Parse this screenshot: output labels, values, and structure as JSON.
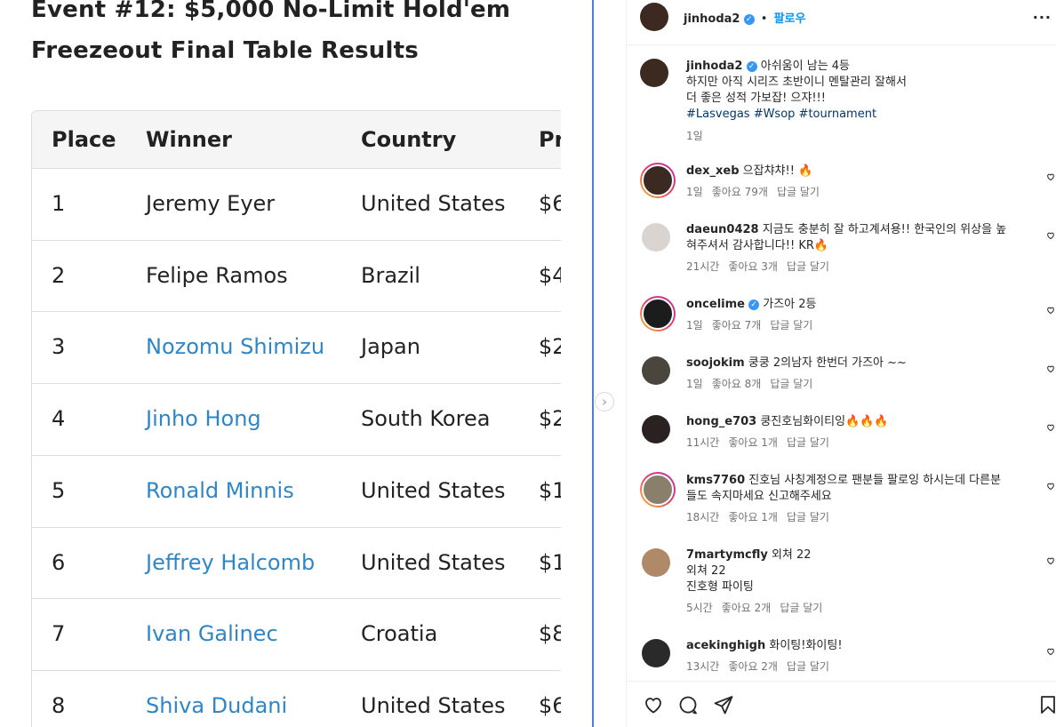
{
  "article": {
    "title": "Event #12: $5,000 No-Limit Hold'em Freezeout Final Table Results",
    "headers": [
      "Place",
      "Winner",
      "Country",
      "Pr"
    ],
    "rows": [
      {
        "place": "1",
        "winner": "Jeremy Eyer",
        "country": "United States",
        "prize": "$6",
        "link": false
      },
      {
        "place": "2",
        "winner": "Felipe Ramos",
        "country": "Brazil",
        "prize": "$4",
        "link": false
      },
      {
        "place": "3",
        "winner": "Nozomu Shimizu",
        "country": "Japan",
        "prize": "$2",
        "link": true
      },
      {
        "place": "4",
        "winner": "Jinho Hong",
        "country": "South Korea",
        "prize": "$2",
        "link": true
      },
      {
        "place": "5",
        "winner": "Ronald Minnis",
        "country": "United States",
        "prize": "$1",
        "link": true
      },
      {
        "place": "6",
        "winner": "Jeffrey Halcomb",
        "country": "United States",
        "prize": "$1",
        "link": true
      },
      {
        "place": "7",
        "winner": "Ivan Galinec",
        "country": "Croatia",
        "prize": "$8",
        "link": true
      },
      {
        "place": "8",
        "winner": "Shiva Dudani",
        "country": "United States",
        "prize": "$6",
        "link": true
      }
    ]
  },
  "post": {
    "author": "jinhoda2",
    "follow_label": "팔로우",
    "separator": "•",
    "more_label": "...",
    "caption_lines": [
      "아쉬움이 남는 4등",
      "하지만 아직 시리즈 초반이니 멘탈관리 잘해서",
      "더 좋은 성적 가보잡! 으쟈!!!"
    ],
    "hashtags": "#Lasvegas #Wsop #tournament",
    "caption_time": "1일"
  },
  "comments": [
    {
      "user": "dex_xeb",
      "verified": false,
      "lines": [
        "으잡챠챠!! 🔥"
      ],
      "time": "1일",
      "likes": "좋아요 79개",
      "reply": "답글 달기",
      "avatar": "#3a2a22",
      "ring": true
    },
    {
      "user": "daeun0428",
      "verified": false,
      "lines": [
        "지금도 충분히 잘 하고계셔용!! 한국인의 위상을 높",
        "혀주셔서 감사합니다!! KR🔥"
      ],
      "time": "21시간",
      "likes": "좋아요 3개",
      "reply": "답글 달기",
      "avatar": "#d9d4cf",
      "ring": false
    },
    {
      "user": "oncelime",
      "verified": true,
      "lines": [
        "가즈아 2등"
      ],
      "time": "1일",
      "likes": "좋아요 7개",
      "reply": "답글 달기",
      "avatar": "#1c1c1c",
      "ring": true
    },
    {
      "user": "soojokim",
      "verified": false,
      "lines": [
        "쿵쿵 2의남자 한번더 가즈아 ~~"
      ],
      "time": "1일",
      "likes": "좋아요 8개",
      "reply": "답글 달기",
      "avatar": "#4a463e",
      "ring": false
    },
    {
      "user": "hong_e703",
      "verified": false,
      "lines": [
        "쿵진호님화이티잉🔥🔥🔥"
      ],
      "time": "11시간",
      "likes": "좋아요 1개",
      "reply": "답글 달기",
      "avatar": "#2a2220",
      "ring": false
    },
    {
      "user": "kms7760",
      "verified": false,
      "lines": [
        "진호님 사칭계정으로 팬분들 팔로잉 하시는데 다른분",
        "들도 속지마세요 신고해주세요"
      ],
      "time": "18시간",
      "likes": "좋아요 1개",
      "reply": "답글 달기",
      "avatar": "#8a7f6a",
      "ring": true
    },
    {
      "user": "7martymcfly",
      "verified": false,
      "lines": [
        "외쳐 22",
        "외쳐 22",
        "진호형 파이팅"
      ],
      "time": "5시간",
      "likes": "좋아요 2개",
      "reply": "답글 달기",
      "avatar": "#b08a68",
      "ring": false
    },
    {
      "user": "acekinghigh",
      "verified": false,
      "lines": [
        "화이팅!화이팅!"
      ],
      "time": "13시간",
      "likes": "좋아요 2개",
      "reply": "답글 달기",
      "avatar": "#2a2a2a",
      "ring": false
    }
  ],
  "icons": {
    "like": "heart-icon",
    "comment": "comment-icon",
    "share": "send-icon",
    "save": "bookmark-icon"
  },
  "colors": {
    "link": "#2e86c8",
    "ig_blue": "#0095f6",
    "hashtag": "#00376b",
    "divider": "#4a7fd6"
  }
}
